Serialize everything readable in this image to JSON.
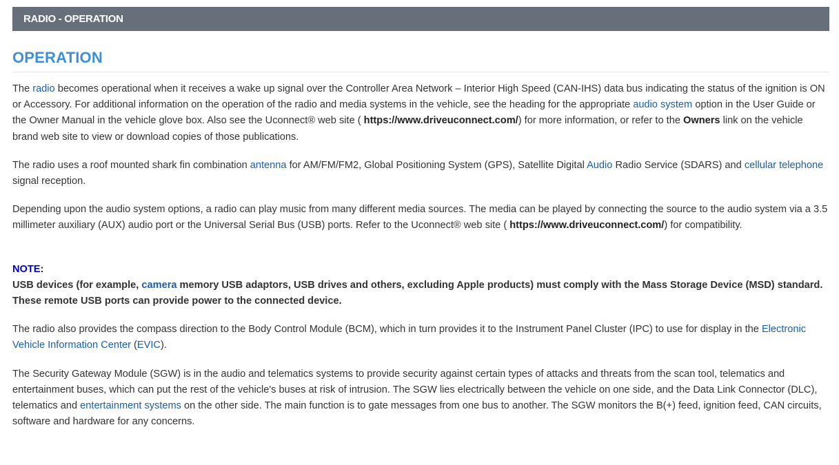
{
  "header": {
    "title": "RADIO - OPERATION"
  },
  "section": {
    "title": "OPERATION"
  },
  "p1": {
    "t1": "The ",
    "link_radio": "radio",
    "t2": " becomes operational when it receives a wake up signal over the Controller Area Network – Interior High Speed (CAN-IHS) data bus indicating the status of the ignition is ON or Accessory. For additional information on the operation of the radio and media systems in the vehicle, see the heading for the appropriate ",
    "link_audio_system": "audio system",
    "t3": " option in the User Guide or the Owner Manual in the vehicle glove box. Also see the Uconnect® web site ( ",
    "url": "https://www.driveuconnect.com/",
    "t4": ") for more information, or refer to the ",
    "owners": "Owners",
    "t5": " link on the vehicle brand web site to view or download copies of those publications."
  },
  "p2": {
    "t1": "The radio uses a roof mounted shark fin combination ",
    "link_antenna": "antenna",
    "t2": " for AM/FM/FM2, Global Positioning System (GPS), Satellite Digital ",
    "link_audio": "Audio",
    "t3": " Radio Service (SDARS) and ",
    "link_cellular": "cellular telephone",
    "t4": " signal reception."
  },
  "p3": {
    "t1": "Depending upon the audio system options, a radio can play music from many different media sources. The media can be played by connecting the source to the audio system via a 3.5 millimeter auxiliary (AUX) audio port or the Universal Serial Bus (USB) ports. Refer to the Uconnect® web site ( ",
    "url": "https://www.driveuconnect.com/",
    "t2": ") for compatibility."
  },
  "note": {
    "label": "NOTE:",
    "t1": "USB devices (for example, ",
    "link_camera": "camera",
    "t2": " memory USB adaptors, USB drives and others, excluding Apple products) must comply with the Mass Storage Device (MSD) standard. These remote USB ports can provide power to the connected device."
  },
  "p4": {
    "t1": "The radio also provides the compass direction to the Body Control Module (BCM), which in turn provides it to the Instrument Panel Cluster (IPC) to use for display in the ",
    "link_evic_name": "Electronic Vehicle Information Center",
    "t2": " (",
    "link_evic": "EVIC",
    "t3": ")."
  },
  "p5": {
    "t1": "The Security Gateway Module (SGW) is in the audio and telematics systems to provide security against certain types of attacks and threats from the scan tool, telematics and entertainment buses, which can put the rest of the vehicle's buses at risk of intrusion. The SGW lies electrically between the vehicle on one side, and the Data Link Connector (DLC), telematics and ",
    "link_entertainment": "entertainment systems",
    "t2": " on the other side. The main function is to gate messages from one bus to another. The SGW monitors the B(+) feed, ignition feed, CAN circuits, software and hardware for any concerns."
  }
}
